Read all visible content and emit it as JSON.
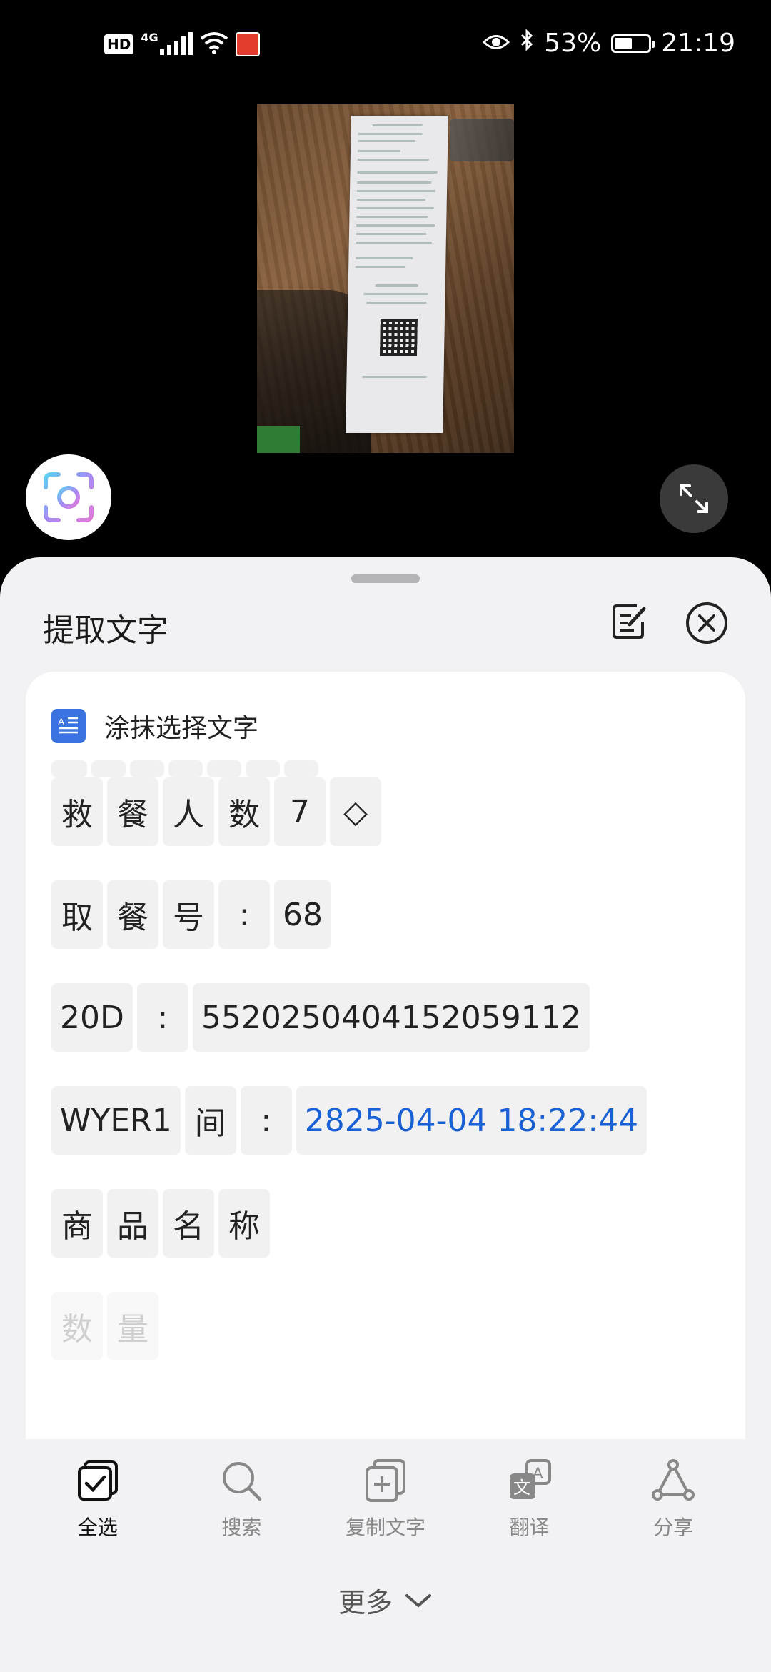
{
  "status_bar": {
    "network_badge": "HD",
    "network_type": "4G",
    "battery_percent": "53%",
    "battery_level": 0.53,
    "time": "21:19"
  },
  "sheet": {
    "title": "提取文字",
    "smear_select_label": "涂抹选择文字"
  },
  "ocr_rows": [
    {
      "tokens": [
        {
          "text": "救"
        },
        {
          "text": "餐"
        },
        {
          "text": "人"
        },
        {
          "text": "数"
        },
        {
          "text": "7"
        },
        {
          "text": "◇"
        }
      ]
    },
    {
      "tokens": [
        {
          "text": "取"
        },
        {
          "text": "餐"
        },
        {
          "text": "号"
        },
        {
          "text": ":"
        },
        {
          "text": "68"
        }
      ]
    },
    {
      "tokens": [
        {
          "text": "20D"
        },
        {
          "text": ":"
        },
        {
          "text": "5520250404152059112"
        }
      ]
    },
    {
      "tokens": [
        {
          "text": "WYER1"
        },
        {
          "text": "间"
        },
        {
          "text": ":"
        },
        {
          "text": "2825-04-04 18:22:44",
          "link": true
        }
      ]
    },
    {
      "tokens": [
        {
          "text": "商"
        },
        {
          "text": "品"
        },
        {
          "text": "名"
        },
        {
          "text": "称"
        }
      ]
    },
    {
      "tokens": [
        {
          "text": "数"
        },
        {
          "text": "量"
        }
      ],
      "faded": true
    }
  ],
  "toolbar": {
    "items": [
      {
        "label": "全选",
        "icon": "select-all-icon",
        "active": true
      },
      {
        "label": "搜索",
        "icon": "search-icon"
      },
      {
        "label": "复制文字",
        "icon": "copy-text-icon"
      },
      {
        "label": "翻译",
        "icon": "translate-icon"
      },
      {
        "label": "分享",
        "icon": "share-icon"
      }
    ]
  },
  "more_label": "更多",
  "colors": {
    "link": "#1b61d6",
    "accent_doc": "#3a73e0",
    "sheet_bg": "#f2f2f4"
  }
}
